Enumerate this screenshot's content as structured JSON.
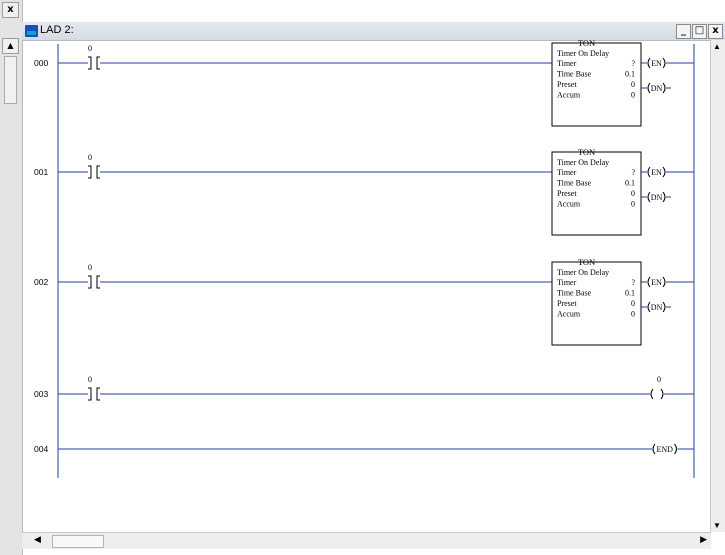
{
  "window": {
    "title": "LAD 2:",
    "minimize_glyph": "_",
    "maximize_glyph": "□",
    "close_glyph": "x"
  },
  "left_strip": {
    "close_glyph": "x",
    "up_glyph": "▲"
  },
  "rungs": [
    {
      "number": "000",
      "contact": "0",
      "instruction": "TON",
      "description": "Timer On Delay",
      "params": [
        {
          "label": "Timer",
          "value": "?"
        },
        {
          "label": "Time Base",
          "value": "0.1"
        },
        {
          "label": "Preset",
          "value": "0"
        },
        {
          "label": "Accum",
          "value": "0"
        }
      ],
      "outputs": [
        "EN",
        "DN"
      ]
    },
    {
      "number": "001",
      "contact": "0",
      "instruction": "TON",
      "description": "Timer On Delay",
      "params": [
        {
          "label": "Timer",
          "value": "?"
        },
        {
          "label": "Time Base",
          "value": "0.1"
        },
        {
          "label": "Preset",
          "value": "0"
        },
        {
          "label": "Accum",
          "value": "0"
        }
      ],
      "outputs": [
        "EN",
        "DN"
      ]
    },
    {
      "number": "002",
      "contact": "0",
      "instruction": "TON",
      "description": "Timer On Delay",
      "params": [
        {
          "label": "Timer",
          "value": "?"
        },
        {
          "label": "Time Base",
          "value": "0.1"
        },
        {
          "label": "Preset",
          "value": "0"
        },
        {
          "label": "Accum",
          "value": "0"
        }
      ],
      "outputs": [
        "EN",
        "DN"
      ]
    },
    {
      "number": "003",
      "contact": "0",
      "coil_addr": "0"
    },
    {
      "number": "004",
      "end_label": "END"
    }
  ],
  "colors": {
    "rail": "#1f3f9e",
    "text": "#000000"
  }
}
